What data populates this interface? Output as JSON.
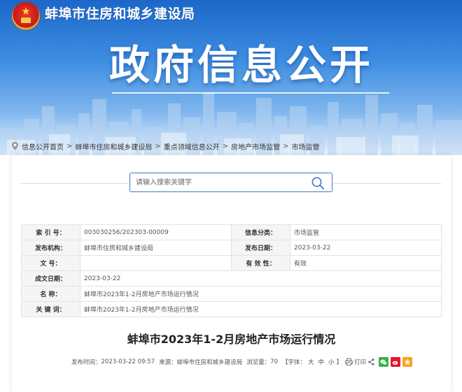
{
  "header": {
    "site_name": "蚌埠市住房和城乡建设局",
    "banner_title": "政府信息公开"
  },
  "breadcrumb": {
    "items": [
      "信息公开首页",
      "蚌埠市住房和城乡建设局",
      "重点领域信息公开",
      "房地产市场监管",
      "市场监管"
    ],
    "separator": ">"
  },
  "search": {
    "placeholder": "请输入搜索关键字"
  },
  "meta": {
    "index_label": "索  引  号：",
    "index_value": "003030256/202303-00009",
    "category_label": "信息分类：",
    "category_value": "市场监管",
    "issuer_label": "发布机构：",
    "issuer_value": "蚌埠市住房和城乡建设局",
    "pubdate_label": "发布日期：",
    "pubdate_value": "2023-03-22",
    "docno_label": "文      号：",
    "docno_value": "",
    "validity_label": "有  效  性：",
    "validity_value": "有效",
    "created_label": "成文日期：",
    "created_value": "2023-03-22",
    "name_label": "名      称：",
    "name_value": "蚌埠市2023年1-2月房地产市场运行情况",
    "keywords_label": "关  键  词：",
    "keywords_value": "蚌埠市2023年1-2月房地产市场运行情况"
  },
  "article": {
    "title": "蚌埠市2023年1-2月房地产市场运行情况",
    "pub_time_label": "发布时间：",
    "pub_time": "2023-03-22 09:57",
    "source_label": "来源：",
    "source": "蚌埠市住房和城乡建设局",
    "views_label": "浏览量：",
    "views": "70",
    "font_label": "【字体：",
    "font_large": "大",
    "font_medium": "中",
    "font_small": "小",
    "font_close": "】",
    "print_label": "打印"
  },
  "colors": {
    "banner_top": "#1c67c9",
    "search_border": "#3b78c4",
    "wechat": "#36b24a",
    "weibo": "#e6162d",
    "qzone": "#f5a623"
  },
  "icons": [
    "emblem-icon",
    "location-pin-icon",
    "search-icon",
    "print-icon",
    "share-icon",
    "wechat-icon",
    "weibo-icon",
    "qzone-icon"
  ]
}
